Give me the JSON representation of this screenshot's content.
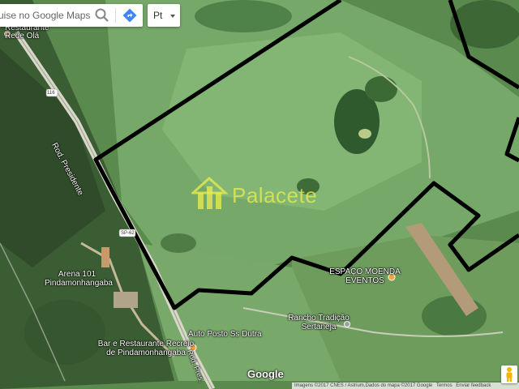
{
  "search": {
    "placeholder": "Pesquise no Google Maps",
    "value": "uise no Google Maps"
  },
  "language_select": {
    "value": "Pt"
  },
  "place_labels": {
    "restaurant_top": [
      "Restaurante",
      "Rede Olá"
    ],
    "road_116": "116",
    "road_name": "Rod. Presidente",
    "road_sp": "SP-62",
    "arena": [
      "Arena 101",
      "Pindamonhangaba"
    ],
    "espaco": [
      "ESPAÇO MOENDA",
      "EVENTOS"
    ],
    "rancho": [
      "Rancho Tradição",
      "Sertaneja"
    ],
    "auto_posto": "Auto Posto Ss Dutra",
    "bar": [
      "Bar e Restaurante Recreio",
      "de Pindamonhangaba"
    ],
    "road_dutra": "Rod. Pres."
  },
  "watermark": {
    "text": "Palacete"
  },
  "google_logo": "Google",
  "attribution": {
    "imagery": "Imagens ©2017 CNES / Astrium,Dados do mapa ©2017 Google",
    "terms": "Termos",
    "feedback": "Enviar feedback"
  },
  "colors": {
    "boundary": "#000000",
    "watermark": "#e8ec4e",
    "poi": "#f2a33a",
    "highway": "#d8d8c8"
  },
  "icons": {
    "search": "search-icon",
    "directions": "directions-icon",
    "dropdown": "chevron-down-icon",
    "pegman": "pegman-icon",
    "poi": "map-pin-icon"
  }
}
